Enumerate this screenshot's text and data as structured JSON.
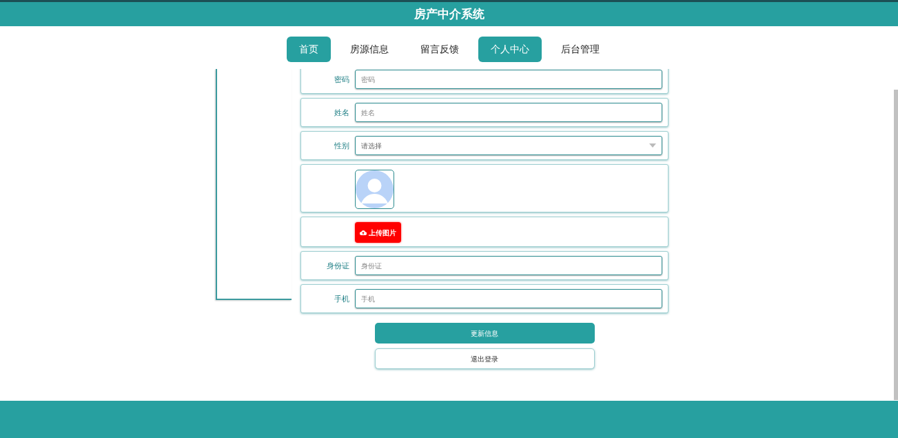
{
  "header": {
    "title": "房产中介系统"
  },
  "nav": [
    {
      "label": "首页",
      "selected": true
    },
    {
      "label": "房源信息",
      "selected": false
    },
    {
      "label": "留言反馈",
      "selected": false
    },
    {
      "label": "个人中心",
      "selected": true
    },
    {
      "label": "后台管理",
      "selected": false
    }
  ],
  "form": [
    {
      "kind": "input",
      "label": "密码",
      "placeholder": "密码"
    },
    {
      "kind": "input",
      "label": "姓名",
      "placeholder": "姓名"
    },
    {
      "kind": "select",
      "label": "性别",
      "placeholder": "请选择"
    },
    {
      "kind": "avatar"
    },
    {
      "kind": "upload",
      "button": "上传图片"
    },
    {
      "kind": "input",
      "label": "身份证",
      "placeholder": "身份证"
    },
    {
      "kind": "input",
      "label": "手机",
      "placeholder": "手机"
    }
  ],
  "buttons": [
    {
      "kind": "primary",
      "label": "更新信息"
    },
    {
      "kind": "secondary",
      "label": "退出登录"
    }
  ]
}
